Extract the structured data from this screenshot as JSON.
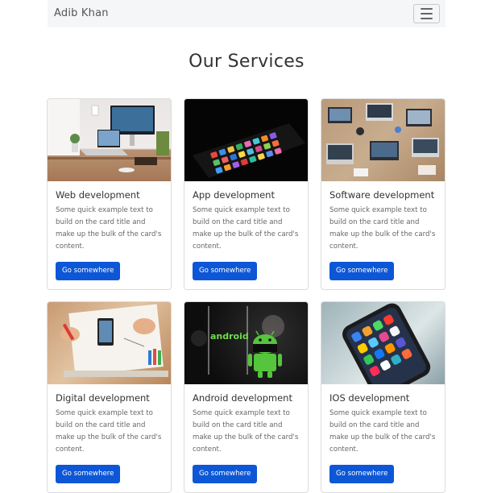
{
  "navbar": {
    "brand": "Adib Khan",
    "toggle_icon": "hamburger-menu-icon"
  },
  "page_title": "Our Services",
  "cards": [
    {
      "title": "Web development",
      "text": "Some quick example text to build on the card title and make up the bulk of the card's content.",
      "button": "Go somewhere",
      "image": "desk-workspace-image"
    },
    {
      "title": "App development",
      "text": "Some quick example text to build on the card title and make up the bulk of the card's content.",
      "button": "Go somewhere",
      "image": "smartphone-apps-image"
    },
    {
      "title": "Software development",
      "text": "Some quick example text to build on the card title and make up the bulk of the card's content.",
      "button": "Go somewhere",
      "image": "team-laptops-image"
    },
    {
      "title": "Digital development",
      "text": "Some quick example text to build on the card title and make up the bulk of the card's content.",
      "button": "Go somewhere",
      "image": "drawing-desk-image"
    },
    {
      "title": "Android development",
      "text": "Some quick example text to build on the card title and make up the bulk of the card's content.",
      "button": "Go somewhere",
      "image": "android-robot-image",
      "image_caption": "android"
    },
    {
      "title": "IOS development",
      "text": "Some quick example text to build on the card title and make up the bulk of the card's content.",
      "button": "Go somewhere",
      "image": "iphone-homescreen-image"
    }
  ],
  "colors": {
    "button": "#0d57d6",
    "navbar_bg": "#f5f6f8"
  }
}
